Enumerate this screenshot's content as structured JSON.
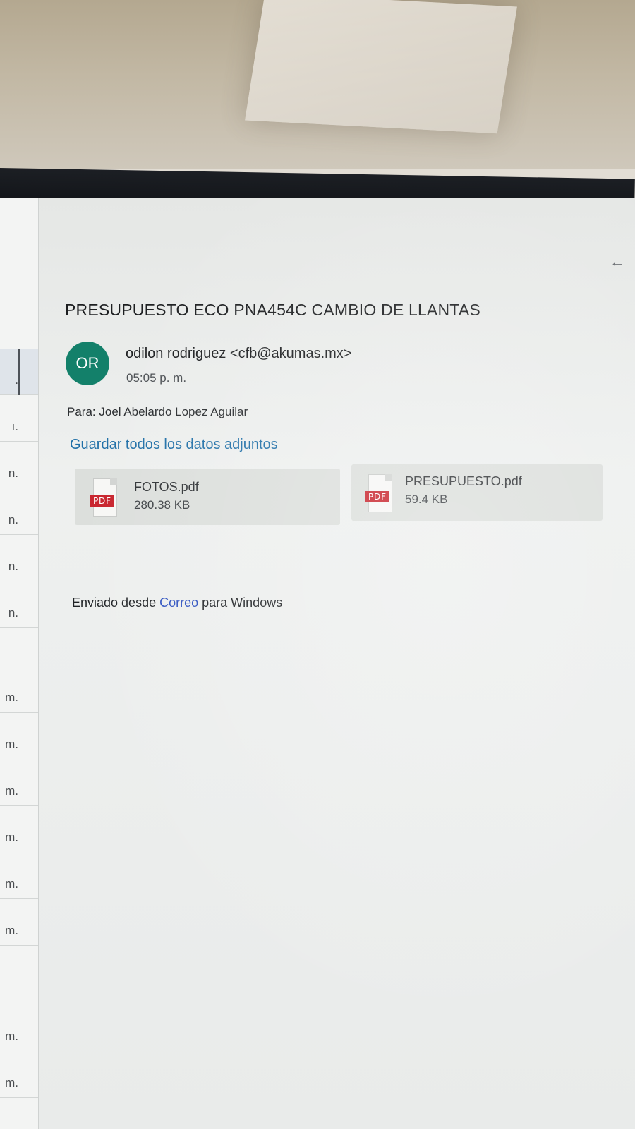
{
  "reading_pane": {
    "subject": "PRESUPUESTO ECO PNA454C CAMBIO DE LLANTAS",
    "avatar_initials": "OR",
    "avatar_color": "#13806a",
    "sender_name": "odilon rodriguez",
    "sender_email": "<cfb@akumas.mx>",
    "time": "05:05 p. m.",
    "to_label": "Para:",
    "to_value": "Joel Abelardo Lopez Aguilar",
    "save_all_label": "Guardar todos los datos adjuntos",
    "back_icon": "←",
    "attachments": [
      {
        "badge": "PDF",
        "name": "FOTOS.pdf",
        "size": "280.38 KB"
      },
      {
        "badge": "PDF",
        "name": "PRESUPUESTO.pdf",
        "size": "59.4 KB"
      }
    ],
    "signature": {
      "prefix": "Enviado desde",
      "link": "Correo",
      "suffix": "para Windows"
    }
  },
  "message_list": {
    "row_times": [
      ".",
      "ı.",
      "n.",
      "n.",
      "n.",
      "n.",
      "m.",
      "m.",
      "m.",
      "m.",
      "m.",
      "m.",
      "m.",
      "m."
    ]
  },
  "colors": {
    "link": "#1f6fa7",
    "pdf_badge": "#c8232c"
  }
}
